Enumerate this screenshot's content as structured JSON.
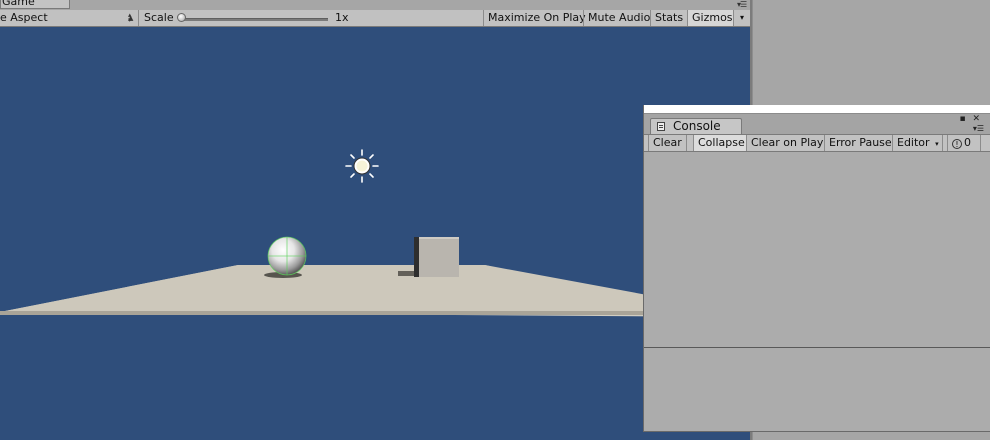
{
  "game": {
    "tab_label": "Game",
    "tab_menu_icon": "context-menu-icon",
    "aspect_label": "e Aspect",
    "scale_label": "Scale",
    "scale_value": "1x",
    "scale_slider_level": 0.0,
    "buttons": {
      "maximize_on_play": "Maximize On Play",
      "mute_audio": "Mute Audio",
      "stats": "Stats",
      "gizmos": "Gizmos"
    },
    "scene_colors": {
      "sky": "#2f4e7b",
      "ground": "#cdc8bb",
      "cube": "#b9b5ae"
    }
  },
  "console": {
    "tab_label": "Console",
    "tab_icon": "console-icon",
    "window_icons": [
      "maximize-icon",
      "close-icon",
      "context-menu-icon"
    ],
    "buttons": {
      "clear": "Clear",
      "collapse": "Collapse",
      "clear_on_play": "Clear on Play",
      "error_pause": "Error Pause",
      "editor": "Editor"
    },
    "error_count": "0"
  }
}
